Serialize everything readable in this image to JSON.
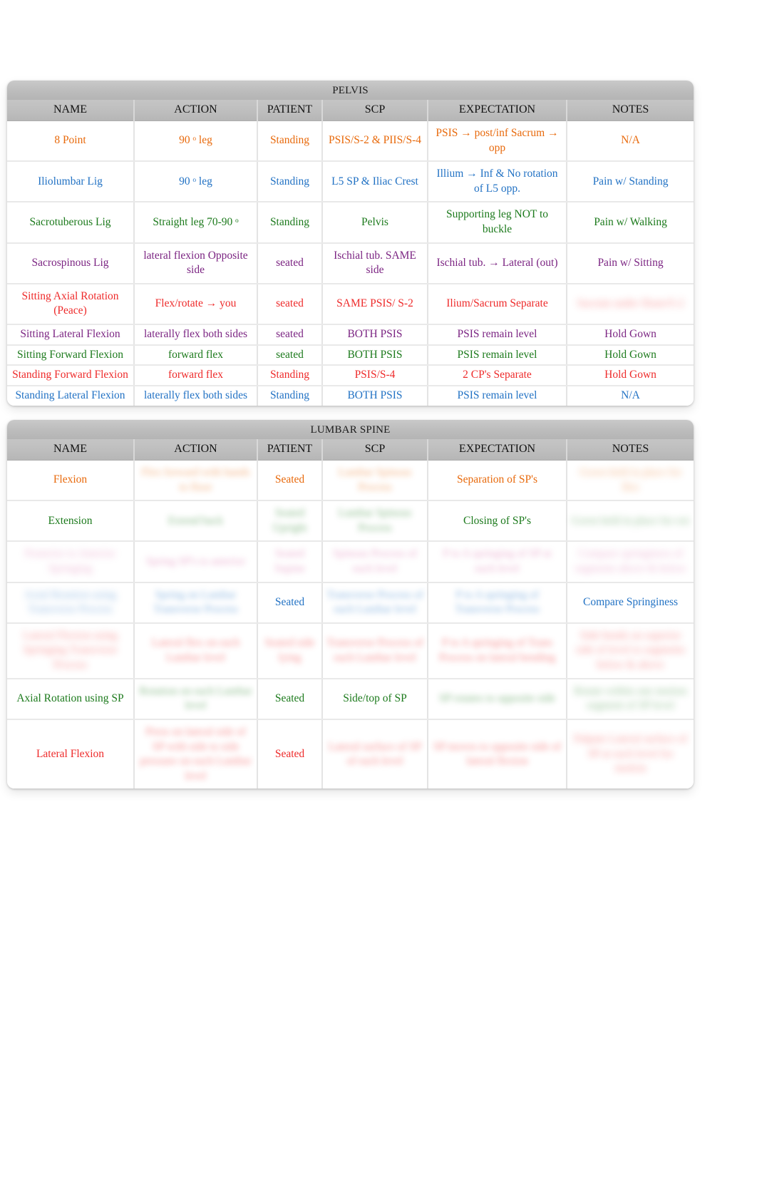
{
  "pelvis": {
    "section_title": "PELVIS",
    "columns": [
      "NAME",
      "ACTION",
      "PATIENT",
      "SCP",
      "EXPECTATION",
      "NOTES"
    ],
    "rows": [
      {
        "color": "orange",
        "name": "8 Point",
        "action": "90 ᵒ leg",
        "patient": "Standing",
        "scp": "PSIS/S-2 & PIIS/S-4",
        "expectation": "PSIS   → post/inf Sacrum    → opp",
        "notes": "N/A",
        "redacted": []
      },
      {
        "color": "blue",
        "name": "Iliolumbar Lig",
        "action": "90 ᵒ leg",
        "patient": "Standing",
        "scp": "L5 SP & Iliac Crest",
        "expectation": "Illium → Inf & No rotation of L5 opp.",
        "notes": "Pain w/  Standing",
        "redacted": []
      },
      {
        "color": "green",
        "name": "Sacrotuberous Lig",
        "action": "Straight  leg  70-90 ᵒ",
        "patient": "Standing",
        "scp": "Pelvis",
        "expectation": "Supporting leg NOT to buckle",
        "notes": "Pain w/  Walking",
        "redacted": []
      },
      {
        "color": "purple",
        "name": "Sacrospinous Lig",
        "action": "lateral flexion Opposite side",
        "patient": "seated",
        "scp": "Ischial tub. SAME side",
        "expectation": "Ischial tub.   → Lateral (out)",
        "notes": "Pain w/  Sitting",
        "redacted": []
      },
      {
        "color": "red",
        "name": "Sitting Axial Rotation (Peace)",
        "action": "Flex/rotate           → you",
        "patient": "seated",
        "scp": "SAME PSIS/ S-2",
        "expectation": "Ilium/Sacrum Separate",
        "notes": "Sacrum under Ilium/S-2",
        "redacted": [
          "notes"
        ]
      },
      {
        "color": "purple",
        "name": "Sitting Lateral Flexion",
        "action": "laterally flex both sides",
        "patient": "seated",
        "scp": "BOTH PSIS",
        "expectation": "PSIS remain level",
        "notes": "Hold Gown",
        "redacted": []
      },
      {
        "color": "green",
        "name": "Sitting Forward Flexion",
        "action": "forward flex",
        "patient": "seated",
        "scp": "BOTH PSIS",
        "expectation": "PSIS remain level",
        "notes": "Hold Gown",
        "redacted": []
      },
      {
        "color": "red",
        "name": "Standing Forward Flexion",
        "action": "forward flex",
        "patient": "Standing",
        "scp": "PSIS/S-4",
        "expectation": "2 CP's Separate",
        "notes": "Hold Gown",
        "redacted": []
      },
      {
        "color": "blue",
        "name": "Standing Lateral Flexion",
        "action": "laterally flex both sides",
        "patient": "Standing",
        "scp": "BOTH PSIS",
        "expectation": "PSIS remain level",
        "notes": "N/A",
        "redacted": []
      }
    ]
  },
  "lumbar": {
    "section_title": "LUMBAR SPINE",
    "columns": [
      "NAME",
      "ACTION",
      "PATIENT",
      "SCP",
      "EXPECTATION",
      "NOTES"
    ],
    "rows": [
      {
        "color": "orange",
        "name": "Flexion",
        "action": "Flex forward with hands to floor",
        "patient": "Seated",
        "scp": "Lumbar Spinous Process",
        "expectation": "Separation of SP's",
        "notes": "Gown held in place for flex",
        "redacted": [
          "action",
          "scp",
          "notes"
        ]
      },
      {
        "color": "green",
        "name": "Extension",
        "action": "Extend back",
        "patient": "Seated Upright",
        "scp": "Lumbar Spinous Process",
        "expectation": "Closing of SP's",
        "notes": "Gown held in place for ext",
        "redacted": [
          "action",
          "patient",
          "scp",
          "notes"
        ]
      },
      {
        "color": "pink",
        "name": "Posterior to Anterior Springing",
        "action": "Spring SP's to anterior",
        "patient": "Seated Supine",
        "scp": "Spinous Process of each level",
        "expectation": "P to A springing of SP at each level",
        "notes": "Compare springiness of segments above & below",
        "redacted": [
          "name",
          "action",
          "patient",
          "scp",
          "expectation",
          "notes"
        ]
      },
      {
        "color": "blue",
        "name": "Axial Rotation using Transverse Process",
        "action": "Spring  on Lumbar Transverse Process",
        "patient": "Seated",
        "scp": "Transverse Process of each Lumbar level",
        "expectation": "P to A springing of Transverse Process",
        "notes": "Compare Springiness",
        "redacted": [
          "name",
          "action",
          "scp",
          "expectation"
        ]
      },
      {
        "color": "red",
        "name": "Lateral Flexion using Springing Transverse Process",
        "action": "Lateral flex on each Lumbar level",
        "patient": "Seated  side lying",
        "scp": "Transverse Process of each Lumbar level",
        "expectation": "P to A springing of Trans Process on lateral bending",
        "notes": "Side bends on superior side of level to segments below & above",
        "redacted": [
          "name",
          "action",
          "patient",
          "scp",
          "expectation",
          "notes"
        ]
      },
      {
        "color": "green",
        "name": "Axial Rotation using SP",
        "action": "Rotation on each Lumbar level",
        "patient": "Seated",
        "scp": "Side/top of SP",
        "expectation": "SP rotates to  opposite side",
        "notes": "Rotate within one motion segment of SP level",
        "redacted": [
          "action",
          "expectation",
          "notes"
        ]
      },
      {
        "color": "red",
        "name": "Lateral Flexion",
        "action": "Press on lateral side of SP with side to side pressure on  each Lumbar level",
        "patient": "Seated",
        "scp": "Lateral surface of SP of each level",
        "expectation": "SP moves to opposite side of lateral flexion",
        "notes": "Palpate Lateral surface of SP at each level for motion",
        "redacted": [
          "action",
          "scp",
          "expectation",
          "notes"
        ]
      }
    ]
  }
}
